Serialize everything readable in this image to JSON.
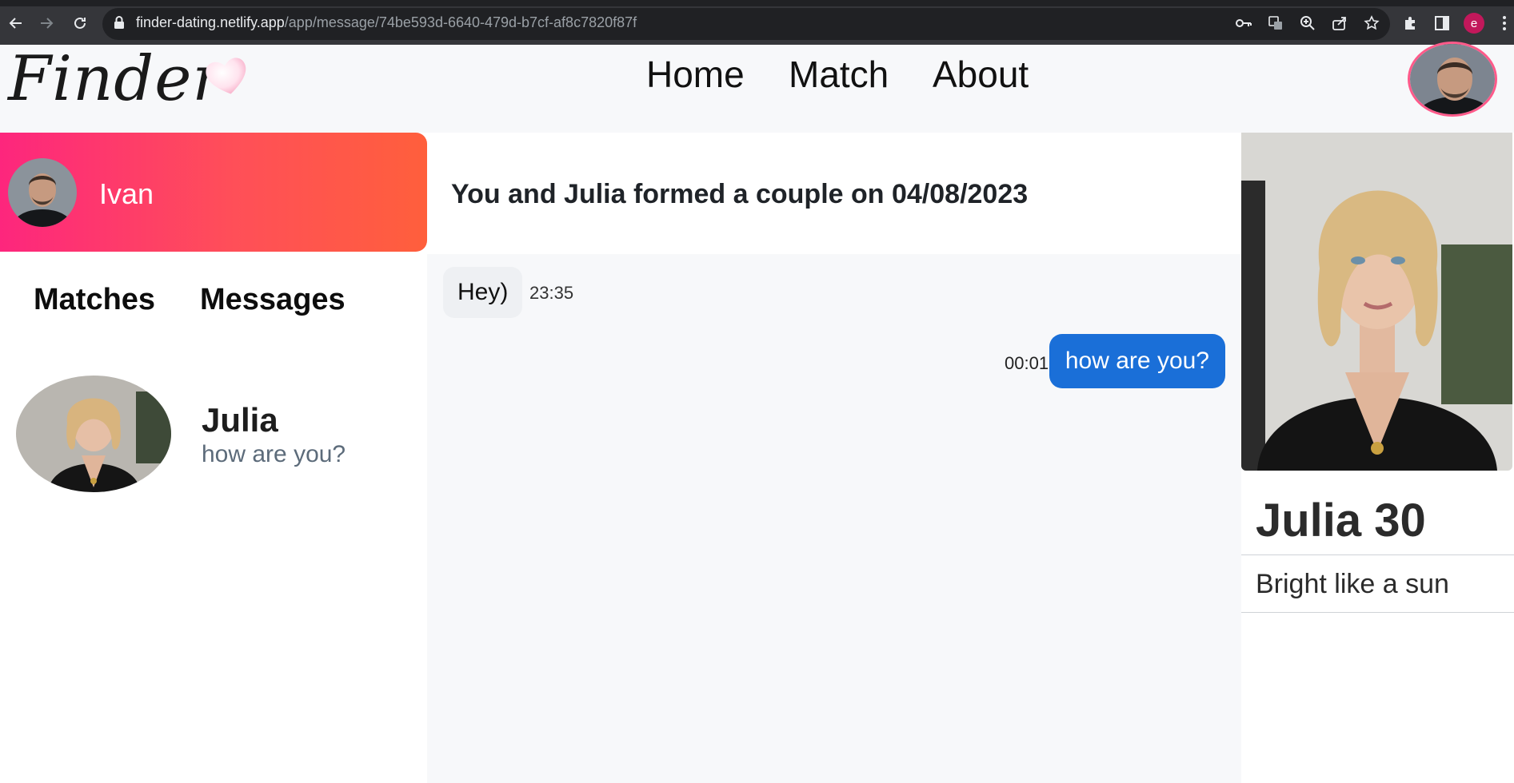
{
  "browser": {
    "url_host": "finder-dating.netlify.app",
    "url_path": "/app/message/74be593d-6640-479d-b7cf-af8c7820f87f",
    "profile_initial": "e"
  },
  "header": {
    "logo": "Finder",
    "nav": [
      "Home",
      "Match",
      "About"
    ]
  },
  "current_user": {
    "name": "Ivan"
  },
  "tabs": [
    "Matches",
    "Messages"
  ],
  "match_list": [
    {
      "name": "Julia",
      "last_message": "how are you?"
    }
  ],
  "chat": {
    "header": "You and Julia formed a couple on 04/08/2023",
    "messages": [
      {
        "text": "Hey)",
        "time": "23:35",
        "direction": "incoming"
      },
      {
        "text": "how are you?",
        "time": "00:01",
        "direction": "outgoing"
      }
    ]
  },
  "profile": {
    "name_age": "Julia 30",
    "bio": "Bright like a sun"
  },
  "colors": {
    "gradient_start": "#fd267d",
    "gradient_end": "#ff5f3c",
    "outgoing_bubble": "#1a6fd8"
  }
}
